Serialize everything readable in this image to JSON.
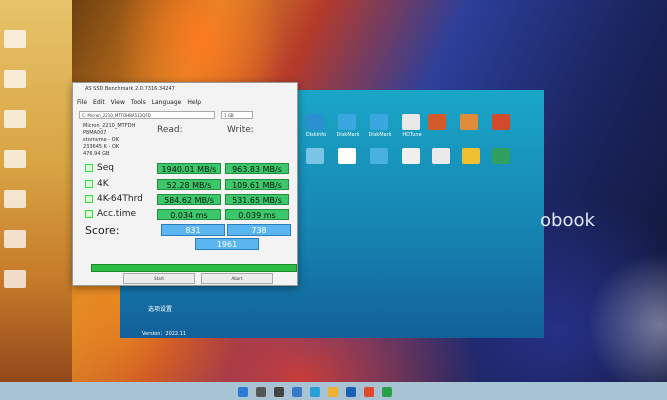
{
  "window": {
    "title": "AS SSD Benchmark 2.0.7316.34247",
    "menu": [
      "File",
      "Edit",
      "View",
      "Tools",
      "Language",
      "Help"
    ],
    "drive_select": "C: Micron_2210_MTFDHBA512QFD",
    "drive_info": [
      "Micron_2210_MTFDH",
      "P8MA007",
      "stornvme - OK",
      "233645 K - OK",
      "476.94 GB"
    ],
    "size_select": "1 GB",
    "col_read": "Read:",
    "col_write": "Write:",
    "rows": [
      {
        "label": "Seq",
        "read": "1940.01 MB/s",
        "write": "963.83 MB/s"
      },
      {
        "label": "4K",
        "read": "52.28 MB/s",
        "write": "109.61 MB/s"
      },
      {
        "label": "4K-64Thrd",
        "read": "584.62 MB/s",
        "write": "531.65 MB/s"
      },
      {
        "label": "Acc.time",
        "read": "0.034 ms",
        "write": "0.039 ms"
      }
    ],
    "score_label": "Score:",
    "score_read": "831",
    "score_write": "738",
    "score_total": "1961",
    "start_button": "Start",
    "abort_button": "Abort"
  },
  "desktop_icons": [
    "DiskInfo",
    "DiskMark",
    "DiskMark",
    "HDTune",
    "",
    ""
  ],
  "brand_text": "obook",
  "bottom_labels": [
    "选项设置",
    "Version：2022.11"
  ]
}
